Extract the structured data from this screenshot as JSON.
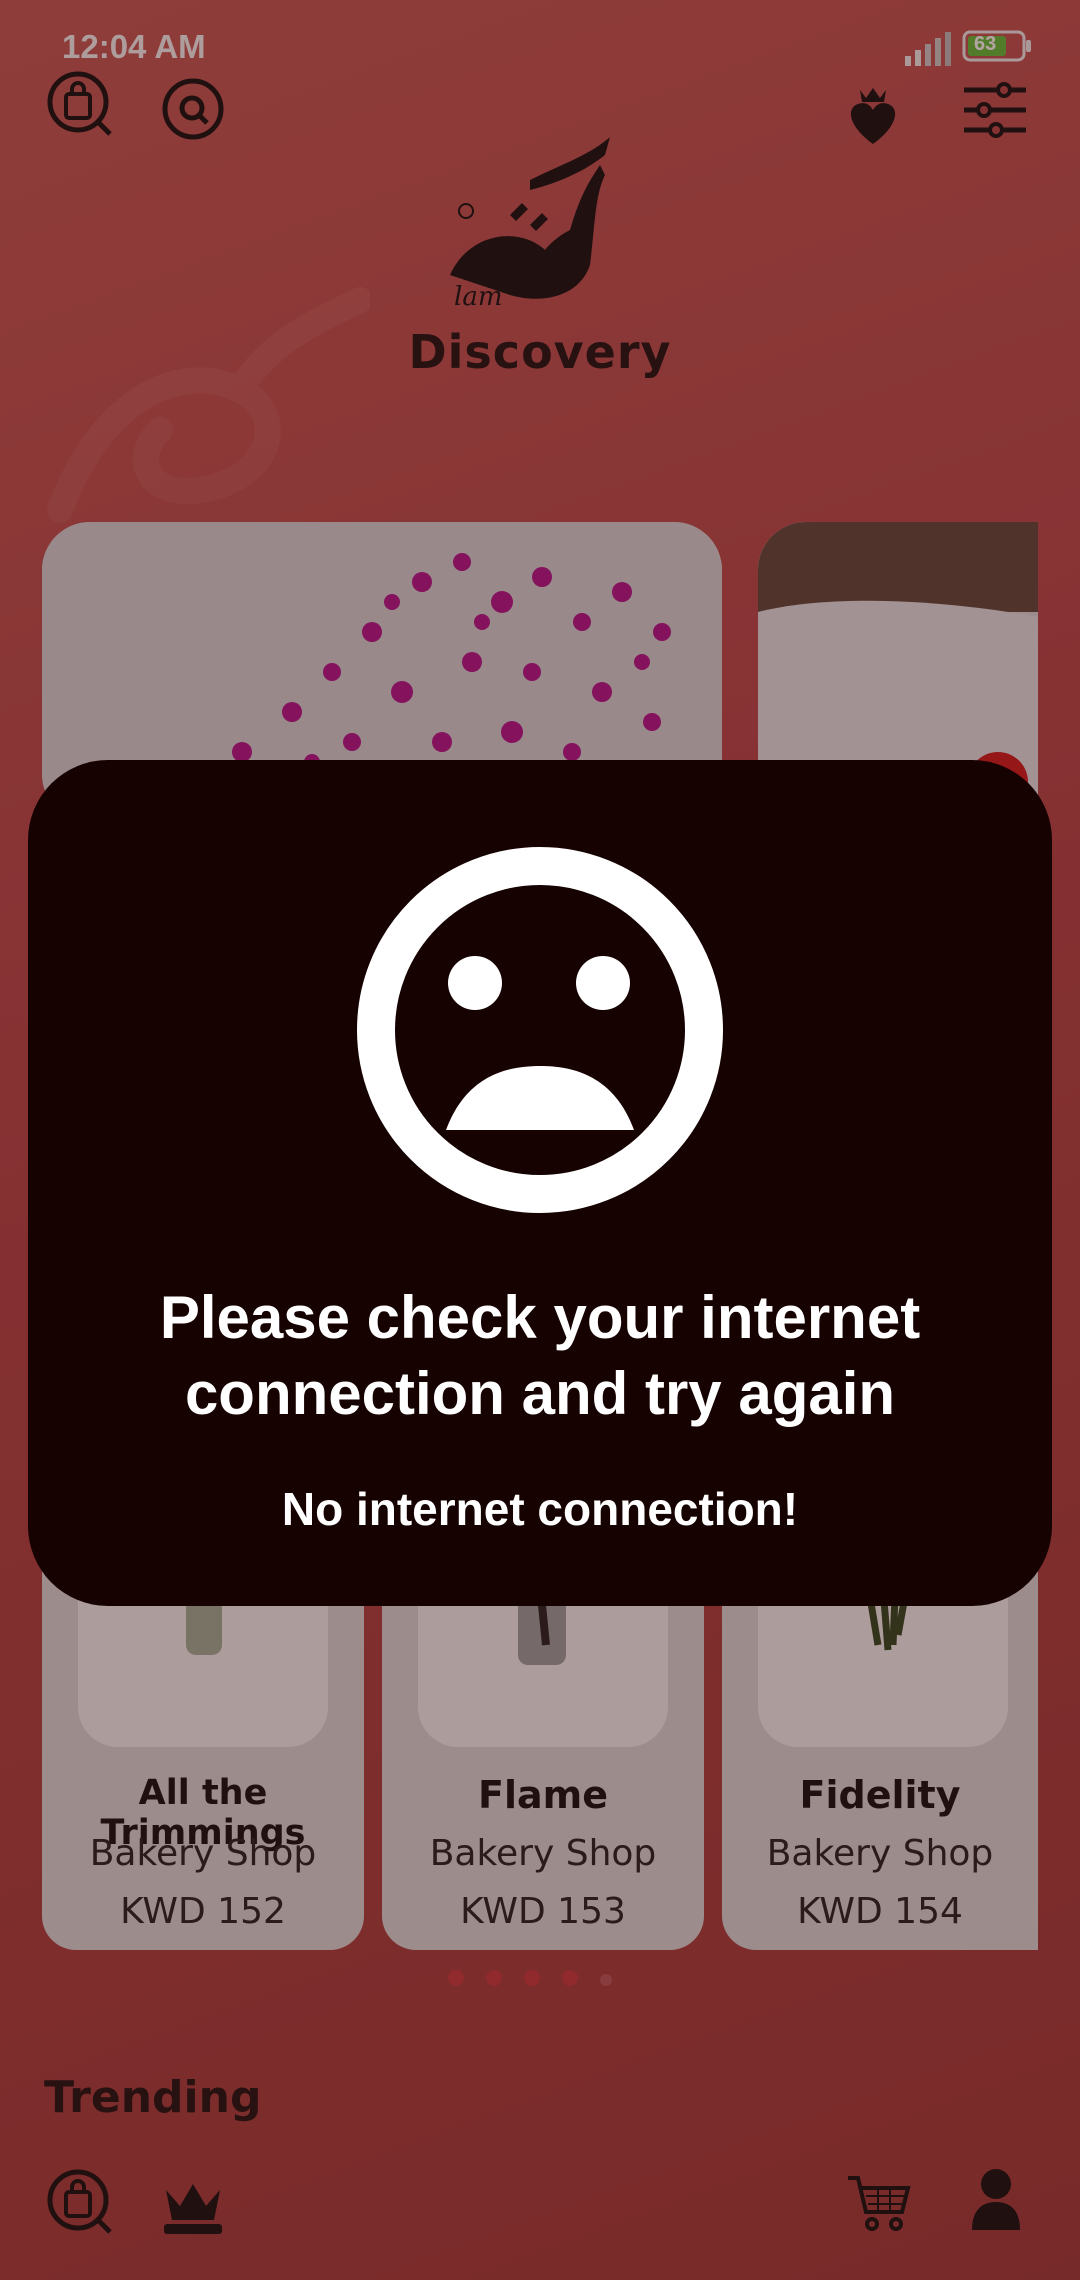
{
  "status_bar": {
    "time": "12:04 AM",
    "battery": "63"
  },
  "header": {
    "title": "Discovery",
    "icons": [
      "shopping-bag-icon",
      "search-icon",
      "crowned-heart-icon",
      "filter-sliders-icon"
    ]
  },
  "products": [
    {
      "name": "All the Trimmings",
      "shop": "Bakery Shop",
      "price": "KWD  152"
    },
    {
      "name": "Flame",
      "shop": "Bakery Shop",
      "price": "KWD  153"
    },
    {
      "name": "Fidelity",
      "shop": "Bakery Shop",
      "price": "KWD  154"
    }
  ],
  "trending": {
    "title": "Trending"
  },
  "bottom_nav": {
    "icons": [
      "shopping-bag-icon",
      "crown-icon",
      "cart-icon",
      "profile-icon"
    ]
  },
  "dialog": {
    "icon": "sad-face-icon",
    "message": "Please check your internet connection and try again",
    "subtitle": "No internet connection!"
  },
  "colors": {
    "background": "#b4474a",
    "dialog": "#170202",
    "accent": "#c63a3f"
  }
}
